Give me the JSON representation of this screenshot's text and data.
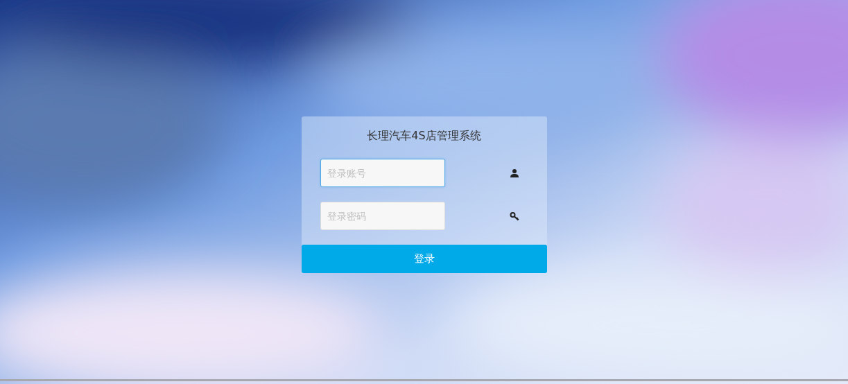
{
  "title": "长理汽车4S店管理系统",
  "fields": [
    {
      "kind": "account",
      "placeholder": "登录账号",
      "focused": true
    },
    {
      "kind": "password",
      "placeholder": "登录密码",
      "focused": false
    }
  ],
  "login_button": {
    "label": "登录"
  }
}
